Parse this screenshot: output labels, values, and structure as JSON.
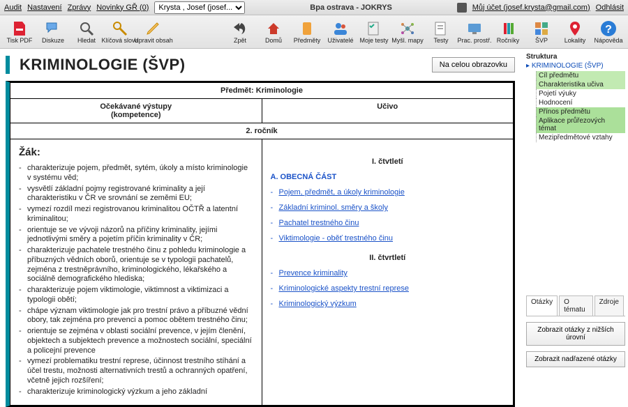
{
  "topbar": {
    "links": [
      "Audit",
      "Nastavení",
      "Zprávy",
      "Novinky GŘ (0)"
    ],
    "user_select": "Krysta , Josef (josef...",
    "app_title": "Bpa ostrava - JOKRYS",
    "account_link": "Můj účet (josef.krysta@gmail.com)",
    "logout": "Odhlásit"
  },
  "toolbar": {
    "left": [
      {
        "id": "pdf",
        "label": "Tisk PDF"
      },
      {
        "id": "discuss",
        "label": "Diskuze"
      },
      {
        "id": "search",
        "label": "Hledat"
      },
      {
        "id": "keywords",
        "label": "Klíčová slova"
      },
      {
        "id": "edit",
        "label": "Upravit obsah"
      }
    ],
    "right": [
      {
        "id": "back",
        "label": "Zpět"
      },
      {
        "id": "home",
        "label": "Domů"
      },
      {
        "id": "subjects",
        "label": "Předměty"
      },
      {
        "id": "users",
        "label": "Uživatelé"
      },
      {
        "id": "mytests",
        "label": "Moje testy"
      },
      {
        "id": "mindmaps",
        "label": "Myšl. mapy"
      },
      {
        "id": "tests",
        "label": "Testy"
      },
      {
        "id": "workenv",
        "label": "Prac. prostř."
      },
      {
        "id": "years",
        "label": "Ročníky"
      },
      {
        "id": "svp",
        "label": "ŠVP"
      },
      {
        "id": "locations",
        "label": "Lokality"
      },
      {
        "id": "help",
        "label": "Nápověda"
      }
    ]
  },
  "document": {
    "title": "KRIMINOLOGIE (ŠVP)",
    "fullscreen": "Na celou obrazovku",
    "subject_row": "Předmět: Kriminologie",
    "col_left": "Očekávané výstupy\n(kompetence)",
    "col_right": "Učivo",
    "year_row": "2. ročník",
    "zak": "Žák:",
    "quarter1": "I. čtvtletí",
    "section_a": "A. OBECNÁ ČÁST",
    "quarter2": "II. čtvrtletí",
    "outcomes": [
      "charakterizuje pojem, předmět, sytém, úkoly a místo kriminologie v systému věd;",
      "vysvětlí základní pojmy registrované kriminality a její charakteristiku v ČR ve srovnání se zeměmi EU;",
      "vymezí rozdíl mezi registrovanou kriminalitou OČTŘ a latentní kriminalitou;",
      "orientuje se ve  vývoji názorů na příčiny kriminality, jejími jednotlivými směry a pojetím příčin kriminality v ČR;",
      "charakterizuje pachatele trestného činu z pohledu kriminologie a příbuzných vědních oborů, orientuje se v typologii pachatelů, zejména z trestněprávního, kriminologického, lékařského a sociálně demografického hlediska;",
      "charakterizuje pojem viktimologie, viktimnost a viktimizaci a typologii obětí;",
      "chápe význam viktimologie jak pro trestní právo a příbuzné vědní obory, tak zejména pro prevenci a pomoc obětem trestného činu;",
      "orientuje se zejména v oblasti sociální prevence, v jejím členění, objektech a subjektech prevence a možnostech sociální, speciální a policejní prevence",
      "vymezí problematiku trestní represe, účinnost trestního stíhání a účel trestu, možnosti alternativních trestů a ochranných opatření, včetně jejich rozšíření;",
      "charakterizuje kriminologický výzkum a jeho základní"
    ],
    "topics": [
      "Pojem, předmět, a úkoly kriminologie",
      "Základní kriminol. směry a školy",
      "Pachatel trestného činu",
      "Viktimologie - oběť trestného činu"
    ],
    "topics2": [
      "Prevence kriminality",
      "Kriminologické aspekty trestní represe",
      "Kriminologický výzkum"
    ]
  },
  "sidebar": {
    "title": "Struktura",
    "root": "KRIMINOLOGIE (ŠVP)",
    "items": [
      {
        "label": "Cíl předmětu",
        "hl": true
      },
      {
        "label": "Charakteristika učiva",
        "hl": true
      },
      {
        "label": "Pojetí výuky",
        "hl": false
      },
      {
        "label": "Hodnocení",
        "hl": false
      },
      {
        "label": "Přínos předmětu",
        "hl": true
      },
      {
        "label": "Aplikace průřezových témat",
        "hl": true
      },
      {
        "label": "Mezipředmětové vztahy",
        "hl": false
      }
    ],
    "tabs": [
      "Otázky",
      "O tématu",
      "Zdroje"
    ],
    "btn1": "Zobrazit otázky z nižších úrovní",
    "btn2": "Zobrazit nadřazené otázky"
  }
}
